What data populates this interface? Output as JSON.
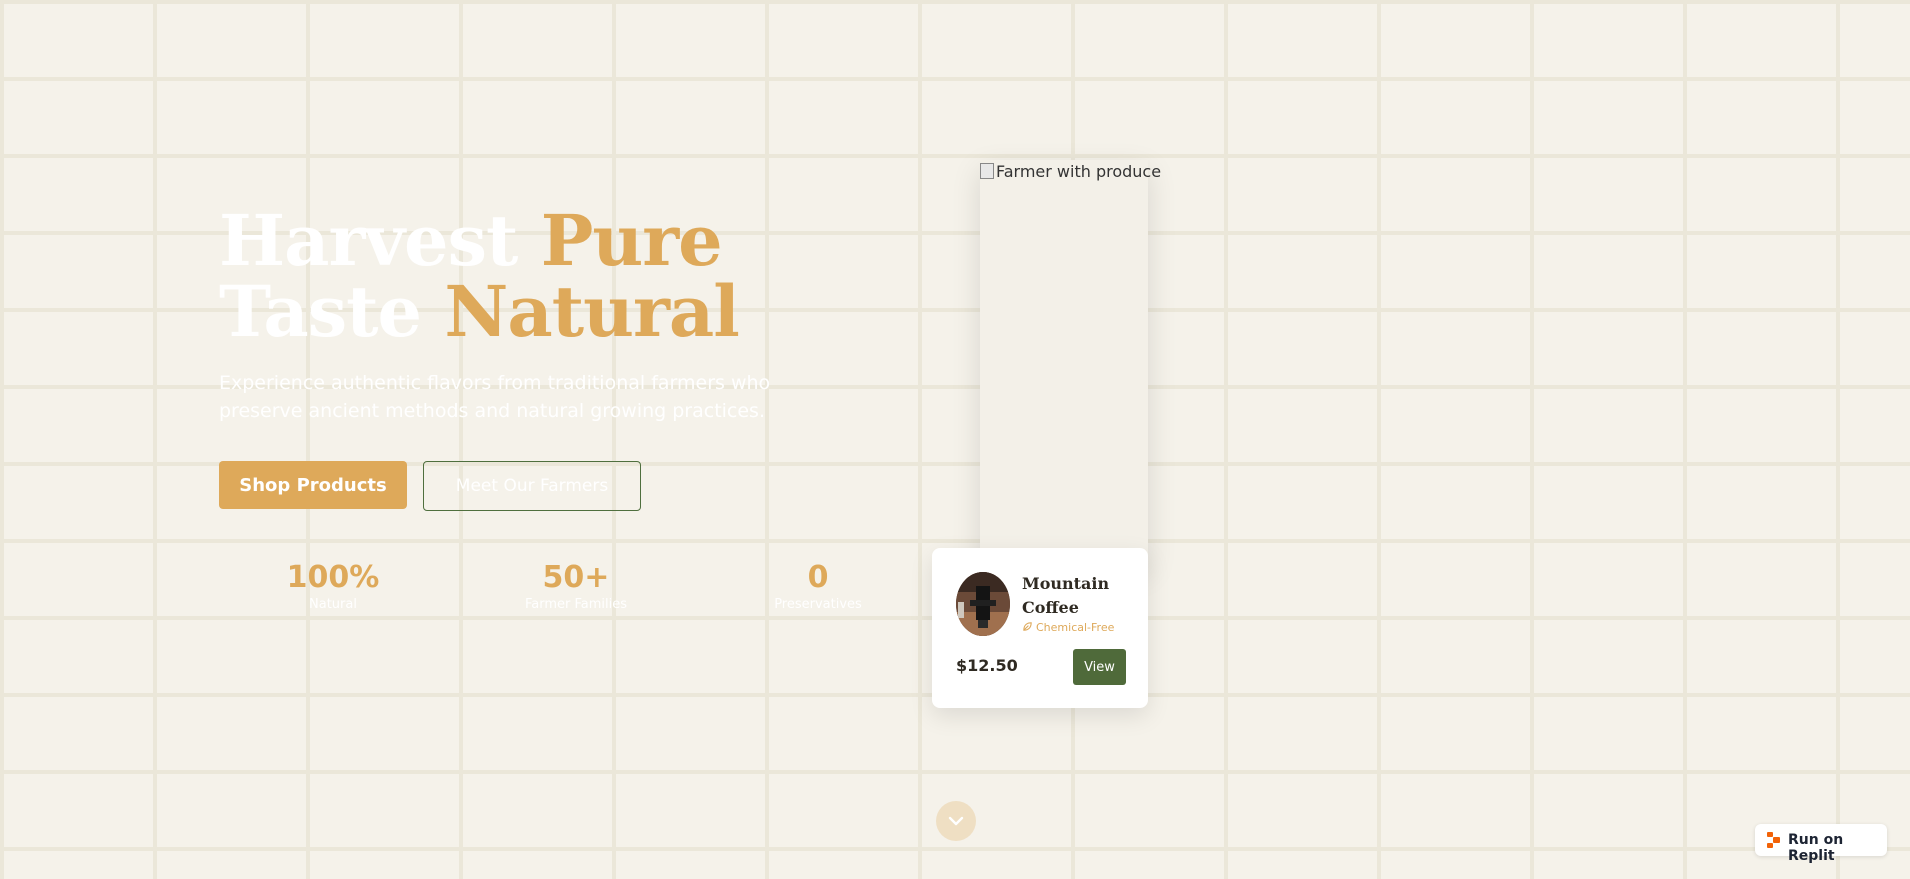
{
  "hero": {
    "title_line1_plain": "Harvest",
    "title_line1_accent": "Pure",
    "title_line2_plain": "Taste",
    "title_line2_accent": "Natural",
    "subtitle": "Experience authentic flavors from traditional farmers who preserve ancient methods and natural growing practices.",
    "primary_button": "Shop Products",
    "secondary_button": "Meet Our Farmers"
  },
  "stats": [
    {
      "value": "100%",
      "label": "Natural"
    },
    {
      "value": "50+",
      "label": "Farmer Families"
    },
    {
      "value": "0",
      "label": "Preservatives"
    }
  ],
  "feature_image": {
    "alt": "Farmer with produce"
  },
  "product_card": {
    "name": "Mountain Coffee",
    "tag": "Chemical-Free",
    "tag_icon": "leaf-icon",
    "price": "$12.50",
    "button": "View"
  },
  "scroll_icon": "chevron-down-icon",
  "replit_badge": {
    "label": "Run on Replit",
    "icon": "replit-logo-icon"
  },
  "colors": {
    "background": "#f5f2ea",
    "accent": "#dea95a",
    "green": "#4f6a3a"
  }
}
